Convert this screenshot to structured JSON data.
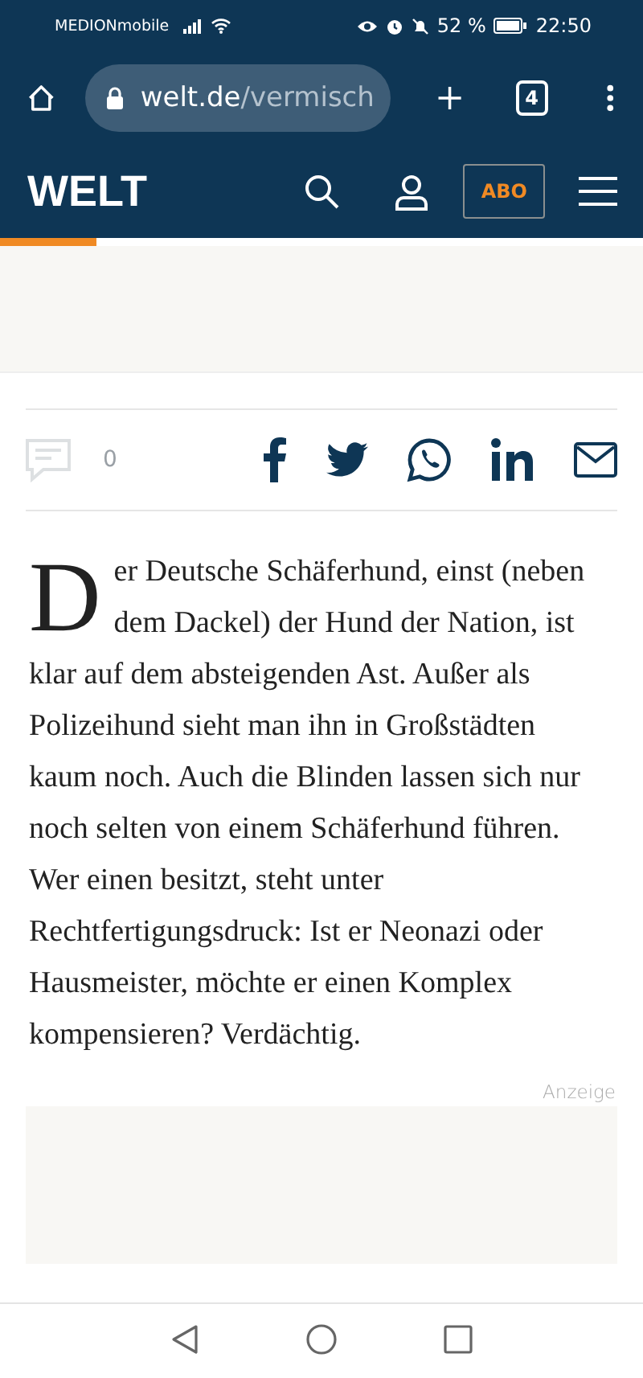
{
  "status_bar": {
    "carrier": "MEDIONmobile",
    "battery": "52 %",
    "time": "22:50"
  },
  "browser": {
    "url_host": "welt.de",
    "url_path": "/vermisch",
    "tab_count": "4"
  },
  "site_header": {
    "logo": "WELT",
    "subscribe": "ABO"
  },
  "reading_progress": {
    "level": 0.15
  },
  "share_bar": {
    "comment_count": "0"
  },
  "article": {
    "drop_cap": "D",
    "text": "er Deutsche Schäferhund, einst (neben dem Dackel) der Hund der Nation, ist klar auf dem absteigenden Ast. Außer als Polizeihund sieht man ihn in Großstädten kaum noch. Auch die Blinden lassen sich nur noch selten von einem Schäferhund führen. Wer einen besitzt, steht unter Rechtfertigungsdruck: Ist er Neonazi oder Hausmeister, möchte er einen Komplex kompensieren? Verdächtig."
  },
  "ad": {
    "label": "Anzeige"
  }
}
